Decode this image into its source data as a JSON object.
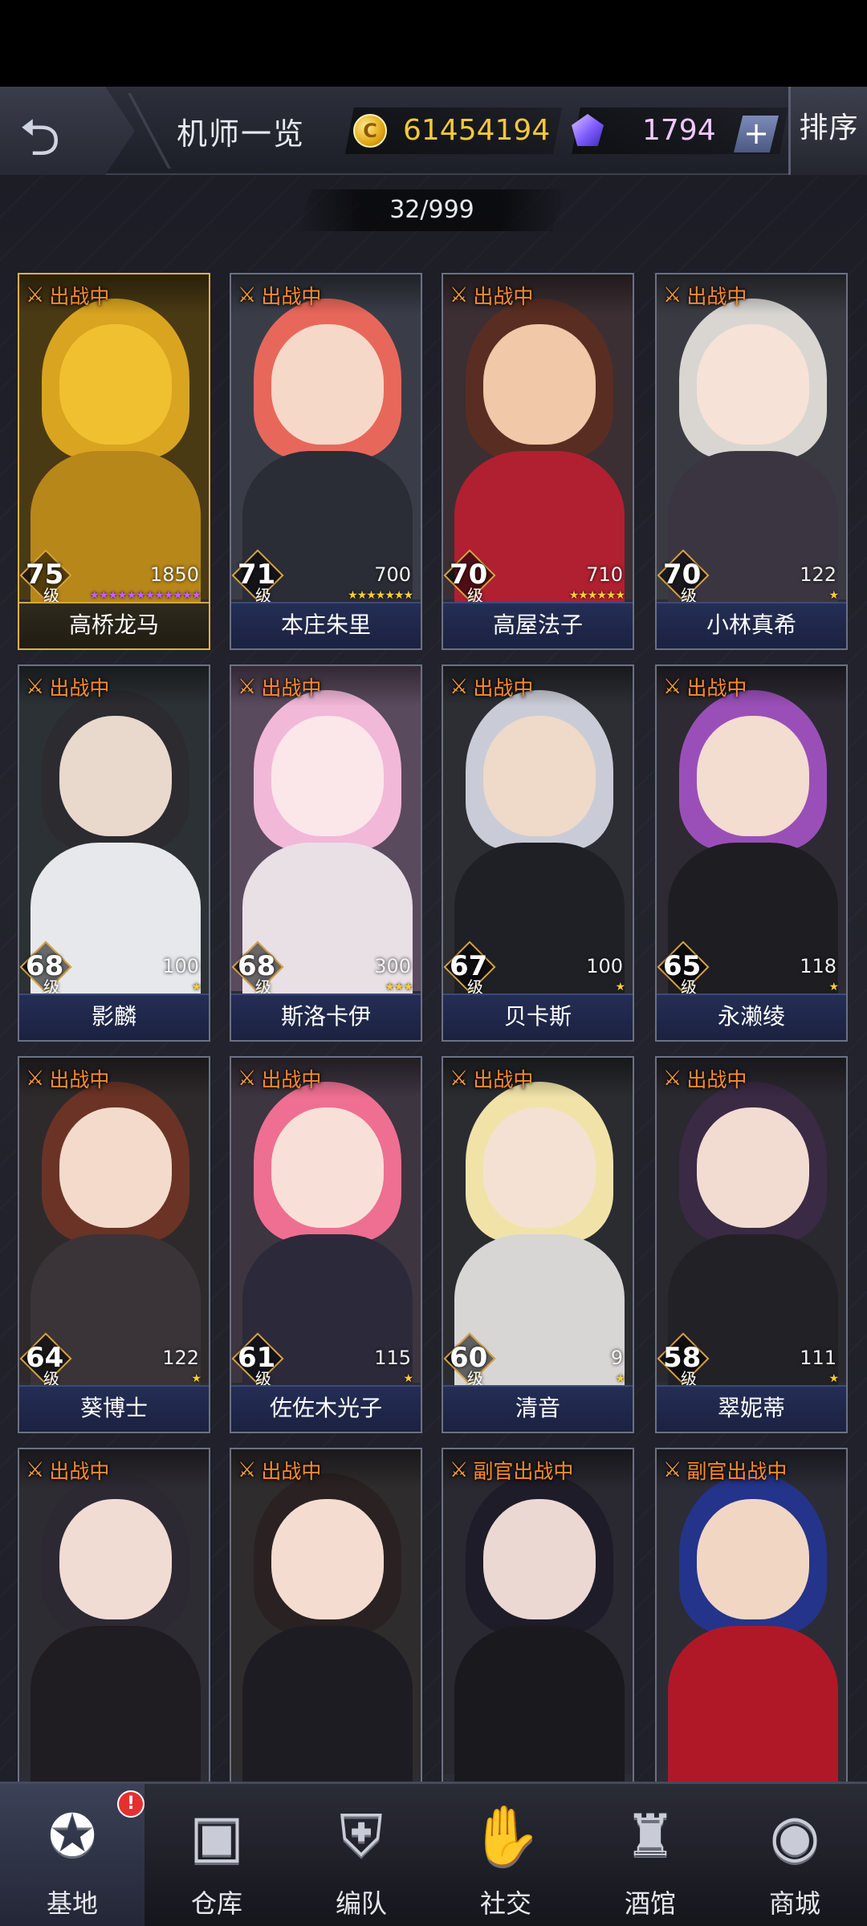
{
  "header": {
    "back_glyph": "⮌",
    "title": "机师一览",
    "coins": "61454194",
    "coin_glyph": "C",
    "gems": "1794",
    "plus_label": "+",
    "sort_label": "排序"
  },
  "roster_count": "32/999",
  "pilots": [
    {
      "status": "出战中",
      "level": "75",
      "level_unit": "级",
      "power": "1850",
      "stars": "★★★★★★★★★★★★",
      "star_color": "purple",
      "name": "高桥龙马",
      "frame": "gold",
      "palette": {
        "bg": "#4a3a14",
        "hair": "#d9a520",
        "head": "#f0c030",
        "body": "#b8871a"
      }
    },
    {
      "status": "出战中",
      "level": "71",
      "level_unit": "级",
      "power": "700",
      "stars": "★★★★★★★",
      "star_color": "gold",
      "name": "本庄朱里",
      "frame": "normal",
      "palette": {
        "bg": "#3a3d48",
        "hair": "#e8675b",
        "head": "#f6d8c8",
        "body": "#2a2c36"
      }
    },
    {
      "status": "出战中",
      "level": "70",
      "level_unit": "级",
      "power": "710",
      "stars": "★★★★★★",
      "star_color": "gold",
      "name": "高屋法子",
      "frame": "normal",
      "palette": {
        "bg": "#3b2f33",
        "hair": "#5a2d22",
        "head": "#f1c8a8",
        "body": "#b02030"
      }
    },
    {
      "status": "出战中",
      "level": "70",
      "level_unit": "级",
      "power": "122",
      "stars": "★",
      "star_color": "gold",
      "name": "小林真希",
      "frame": "normal",
      "palette": {
        "bg": "#3a3b42",
        "hair": "#d9d6d2",
        "head": "#f6e2d6",
        "body": "#3a3540"
      }
    },
    {
      "status": "出战中",
      "level": "68",
      "level_unit": "级",
      "power": "100",
      "stars": "★",
      "star_color": "gold",
      "name": "影麟",
      "frame": "normal",
      "palette": {
        "bg": "#2c3135",
        "hair": "#2b2b30",
        "head": "#e9d8cc",
        "body": "#e6e8ec"
      }
    },
    {
      "status": "出战中",
      "level": "68",
      "level_unit": "级",
      "power": "300",
      "stars": "★★★",
      "star_color": "gold",
      "name": "斯洛卡伊",
      "frame": "normal",
      "palette": {
        "bg": "#5a4a5e",
        "hair": "#f2b8d8",
        "head": "#fbe6ea",
        "body": "#e9e0e6"
      }
    },
    {
      "status": "出战中",
      "level": "67",
      "level_unit": "级",
      "power": "100",
      "stars": "★",
      "star_color": "gold",
      "name": "贝卡斯",
      "frame": "normal",
      "palette": {
        "bg": "#2c2e34",
        "hair": "#c9ccd6",
        "head": "#efd9c8",
        "body": "#1f2026"
      }
    },
    {
      "status": "出战中",
      "level": "65",
      "level_unit": "级",
      "power": "118",
      "stars": "★",
      "star_color": "gold",
      "name": "永濑绫",
      "frame": "normal",
      "palette": {
        "bg": "#2d2a33",
        "hair": "#9a4fb8",
        "head": "#f3dcd0",
        "body": "#1e1d22"
      }
    },
    {
      "status": "出战中",
      "level": "64",
      "level_unit": "级",
      "power": "122",
      "stars": "★",
      "star_color": "gold",
      "name": "葵博士",
      "frame": "normal",
      "palette": {
        "bg": "#2e2a2c",
        "hair": "#6b3326",
        "head": "#f4dacb",
        "body": "#3a3438"
      }
    },
    {
      "status": "出战中",
      "level": "61",
      "level_unit": "级",
      "power": "115",
      "stars": "★",
      "star_color": "gold",
      "name": "佐佐木光子",
      "frame": "normal",
      "palette": {
        "bg": "#3d3540",
        "hair": "#ee6f92",
        "head": "#f8e0d8",
        "body": "#2c2a3a"
      }
    },
    {
      "status": "出战中",
      "level": "60",
      "level_unit": "级",
      "power": "9",
      "stars": "★",
      "star_color": "gold",
      "name": "清音",
      "frame": "normal",
      "palette": {
        "bg": "#2a2c30",
        "hair": "#f1e3a8",
        "head": "#f5e1d3",
        "body": "#d8d6d4"
      }
    },
    {
      "status": "出战中",
      "level": "58",
      "level_unit": "级",
      "power": "111",
      "stars": "★",
      "star_color": "gold",
      "name": "翠妮蒂",
      "frame": "normal",
      "palette": {
        "bg": "#2b2930",
        "hair": "#3a2a44",
        "head": "#f2dcd2",
        "body": "#222126"
      }
    },
    {
      "status": "出战中",
      "level": "",
      "level_unit": "",
      "power": "",
      "stars": "",
      "star_color": "gold",
      "name": "",
      "frame": "normal",
      "palette": {
        "bg": "#2e2c33",
        "hair": "#2d2933",
        "head": "#f1dcd4",
        "body": "#1f1d22"
      }
    },
    {
      "status": "出战中",
      "level": "",
      "level_unit": "",
      "power": "",
      "stars": "",
      "star_color": "gold",
      "name": "",
      "frame": "normal",
      "palette": {
        "bg": "#2f2c2e",
        "hair": "#2a2222",
        "head": "#f4ddd0",
        "body": "#1d1c22"
      }
    },
    {
      "status": "副官出战中",
      "level": "",
      "level_unit": "",
      "power": "",
      "stars": "",
      "star_color": "gold",
      "name": "",
      "frame": "normal",
      "palette": {
        "bg": "#2a2830",
        "hair": "#1e1c28",
        "head": "#ecd8d2",
        "body": "#1a191e"
      }
    },
    {
      "status": "副官出战中",
      "level": "",
      "level_unit": "",
      "power": "",
      "stars": "",
      "star_color": "gold",
      "name": "",
      "frame": "normal",
      "palette": {
        "bg": "#2c2c36",
        "hair": "#24348a",
        "head": "#f2d6c4",
        "body": "#b01828"
      }
    }
  ],
  "nav": [
    {
      "label": "基地",
      "icon": "base-icon",
      "glyph": "✪",
      "active": true,
      "alert": "!"
    },
    {
      "label": "仓库",
      "icon": "warehouse-icon",
      "glyph": "▣",
      "active": false
    },
    {
      "label": "编队",
      "icon": "formation-icon",
      "glyph": "⛨",
      "active": false
    },
    {
      "label": "社交",
      "icon": "social-icon",
      "glyph": "✋",
      "active": false
    },
    {
      "label": "酒馆",
      "icon": "tavern-icon",
      "glyph": "♜",
      "active": false
    },
    {
      "label": "商城",
      "icon": "shop-icon",
      "glyph": "◉",
      "active": false
    }
  ],
  "colors": {
    "accent_gold": "#f5c83a",
    "status_orange": "#ff8a2c",
    "name_bar": "#1b2140"
  }
}
